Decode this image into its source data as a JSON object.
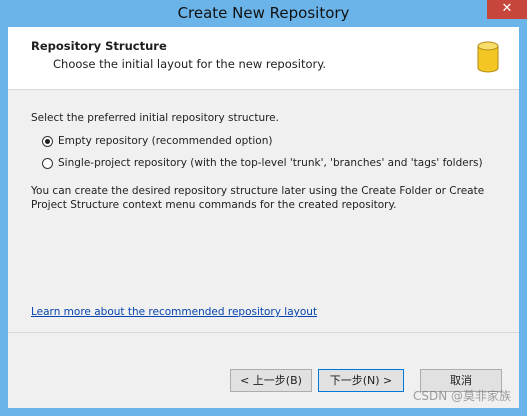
{
  "window": {
    "title": "Create New Repository",
    "close_label": "✕"
  },
  "header": {
    "title": "Repository Structure",
    "subtitle": "Choose the initial layout for the new repository.",
    "icon": "database-icon"
  },
  "body": {
    "prompt": "Select the preferred initial repository structure.",
    "options": [
      {
        "label": "Empty repository (recommended option)",
        "selected": true
      },
      {
        "label": "Single-project repository (with the top-level 'trunk', 'branches' and 'tags' folders)",
        "selected": false
      }
    ],
    "info": "You can create the desired repository structure later using the Create Folder or Create Project Structure context menu commands for the created repository.",
    "link": "Learn more about the recommended repository layout"
  },
  "buttons": {
    "back": "< 上一步(B)",
    "next": "下一步(N) >",
    "cancel": "取消"
  },
  "watermark": "CSDN @莫非家族",
  "colors": {
    "titlebar": "#6ab4ea",
    "close": "#c7463b",
    "link": "#0645ad",
    "icon_yellow": "#f3c623"
  }
}
